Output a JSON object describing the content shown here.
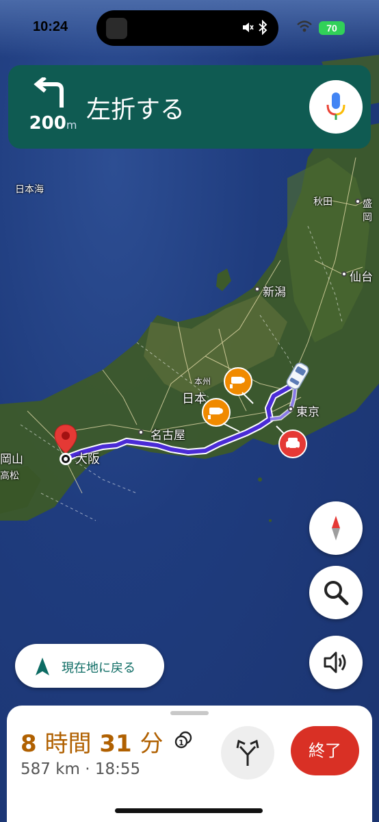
{
  "status_bar": {
    "time": "10:24",
    "battery": "70"
  },
  "navigation": {
    "distance_value": "200",
    "distance_unit": "m",
    "instruction": "左折する"
  },
  "map_labels": {
    "sea_of_japan": "日本海",
    "akita": "秋田",
    "morioka": "盛岡",
    "sendai": "仙台",
    "niigata": "新潟",
    "honshu": "本州",
    "japan": "日本",
    "tokyo": "東京",
    "nagoya": "名古屋",
    "osaka": "大阪",
    "okayama": "岡山",
    "takamatsu": "高松"
  },
  "recenter_label": "現在地に戻る",
  "trip": {
    "hours": "8",
    "hours_unit": "時間",
    "minutes": "31",
    "minutes_unit": "分",
    "distance": "587 km",
    "separator": "·",
    "arrival": "18:55",
    "route_badge": "1"
  },
  "end_button": "終了",
  "colors": {
    "banner": "#0f5b52",
    "route": "#4a2bd6",
    "eta": "#b06000",
    "end": "#d93025",
    "camera_pin": "#f08a00"
  },
  "icons": [
    "turn-left-icon",
    "microphone-icon",
    "compass-icon",
    "search-icon",
    "sound-icon",
    "navigation-arrow-icon",
    "alt-route-icon",
    "speed-camera-icon",
    "traffic-incident-icon",
    "destination-pin-icon",
    "car-icon"
  ]
}
